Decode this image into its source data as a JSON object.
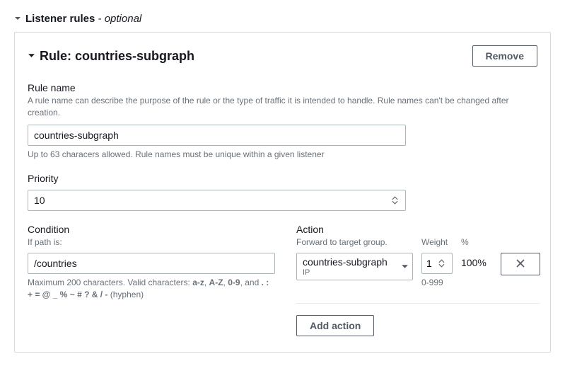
{
  "section": {
    "title": "Listener rules",
    "optional": " - optional"
  },
  "rule": {
    "title_prefix": "Rule: ",
    "title_name": "countries-subgraph",
    "remove_label": "Remove"
  },
  "ruleName": {
    "label": "Rule name",
    "desc": "A rule name can describe the purpose of the rule or the type of traffic it is intended to handle. Rule names can't be changed after creation.",
    "value": "countries-subgraph",
    "hint": "Up to 63 characers allowed. Rule names must be unique within a given listener"
  },
  "priority": {
    "label": "Priority",
    "value": "10"
  },
  "condition": {
    "label": "Condition",
    "sublabel": "If path is:",
    "value": "/countries",
    "hint_prefix": "Maximum 200 characters. Valid characters: ",
    "hint_bold1": "a-z",
    "hint_sep1": ", ",
    "hint_bold2": "A-Z",
    "hint_sep2": ", ",
    "hint_bold3": "0-9",
    "hint_sep3": ", and ",
    "hint_bold4": ". : + = @ _ % ~ # ? & / -",
    "hint_suffix": " (hyphen)"
  },
  "action": {
    "label": "Action",
    "sublabel": "Forward to target group.",
    "select_value": "countries-subgraph",
    "select_sub": "IP",
    "weight_label": "Weight",
    "weight_value": "1",
    "weight_hint": "0-999",
    "percent_label": "%",
    "percent_value": "100%",
    "add_action_label": "Add action"
  }
}
